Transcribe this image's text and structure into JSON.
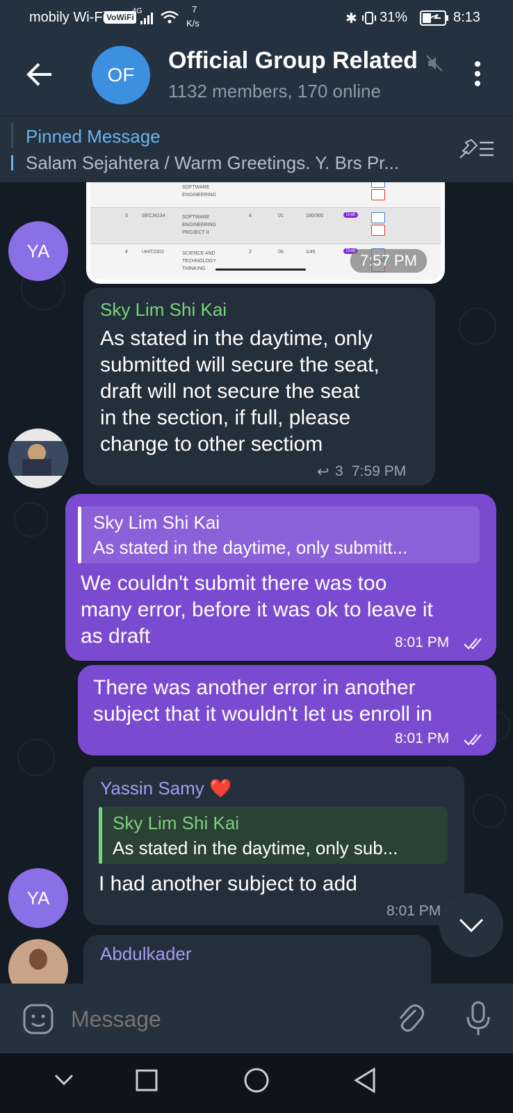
{
  "status_bar": {
    "carrier": "mobily Wi-Fi",
    "volte_badge": "VoWiFi",
    "network_type": "4G",
    "speed_value": "7",
    "speed_unit": "K/s",
    "battery_percent": "31%",
    "time": "8:13"
  },
  "header": {
    "avatar_initials": "OF",
    "title": "Official Group Related",
    "subtitle": "1132 members, 170 online",
    "avatar_color": "#3d8fe0"
  },
  "pinned": {
    "label": "Pinned Message",
    "text": "Salam Sejahtera / Warm Greetings.  Y. Brs Pr..."
  },
  "screenshot_message": {
    "time": "7:57 PM",
    "rows": [
      {
        "no": "",
        "code": "",
        "name": "SOFTWARE ENGINEERING",
        "credit": "",
        "section": "",
        "seats": "",
        "status": ""
      },
      {
        "no": "3",
        "code": "SECJ4134",
        "name": "SOFTWARE ENGINEERING PROJECT II",
        "credit": "4",
        "section": "01",
        "seats": "180/300",
        "status": "Draft"
      },
      {
        "no": "4",
        "code": "UHIT2302",
        "name": "SCIENCE AND TECHNOLOGY THINKING",
        "credit": "2",
        "section": "09",
        "seats": "1/45",
        "status": "Draft"
      }
    ],
    "sender_avatar_initials": "YA"
  },
  "messages": {
    "m1": {
      "sender": "Sky Lim Shi Kai",
      "lines": [
        "As stated in the daytime, only",
        "submitted will secure the seat,",
        "draft will not secure the seat",
        "in the section, if full, please",
        "change to other sectiom"
      ],
      "reply_count": "3",
      "time": "7:59 PM"
    },
    "m2": {
      "quote_sender": "Sky Lim Shi Kai",
      "quote_text": "As stated in the daytime, only submitt...",
      "lines": [
        "We couldn't submit there was too",
        "many error, before it was ok to leave it",
        "as draft"
      ],
      "time": "8:01 PM"
    },
    "m3": {
      "lines": [
        "There was another error in another",
        "subject that it wouldn't let us enroll in"
      ],
      "time": "8:01 PM"
    },
    "m4": {
      "sender": "Yassin Samy",
      "sender_emoji": "❤️",
      "quote_sender": "Sky Lim Shi Kai",
      "quote_text": "As stated in the daytime, only sub...",
      "text": "I had another subject to add",
      "time": "8:01 PM",
      "avatar_initials": "YA"
    },
    "m5": {
      "sender": "Abdulkader"
    }
  },
  "input": {
    "placeholder": "Message"
  },
  "colors": {
    "accent": "#6ab2f2",
    "outgoing_bubble": "#7a4ad1",
    "incoming_bubble": "#232f3a",
    "avatar_purple": "#8b6fe6"
  }
}
